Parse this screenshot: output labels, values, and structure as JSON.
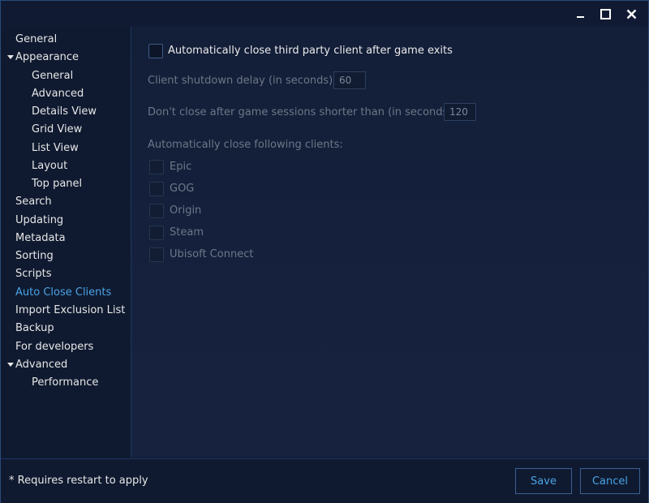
{
  "window": {
    "controls": {
      "minimize": "minimize-icon",
      "maximize": "maximize-icon",
      "close": "close-icon"
    }
  },
  "sidebar": {
    "items": [
      {
        "label": "General",
        "level": 0
      },
      {
        "label": "Appearance",
        "level": 0,
        "expanded": true
      },
      {
        "label": "General",
        "level": 1
      },
      {
        "label": "Advanced",
        "level": 1
      },
      {
        "label": "Details View",
        "level": 1
      },
      {
        "label": "Grid View",
        "level": 1
      },
      {
        "label": "List View",
        "level": 1
      },
      {
        "label": "Layout",
        "level": 1
      },
      {
        "label": "Top panel",
        "level": 1
      },
      {
        "label": "Search",
        "level": 0
      },
      {
        "label": "Updating",
        "level": 0
      },
      {
        "label": "Metadata",
        "level": 0
      },
      {
        "label": "Sorting",
        "level": 0
      },
      {
        "label": "Scripts",
        "level": 0
      },
      {
        "label": "Auto Close Clients",
        "level": 0,
        "selected": true
      },
      {
        "label": "Import Exclusion List",
        "level": 0
      },
      {
        "label": "Backup",
        "level": 0
      },
      {
        "label": "For developers",
        "level": 0
      },
      {
        "label": "Advanced",
        "level": 0,
        "expanded": true
      },
      {
        "label": "Performance",
        "level": 1
      }
    ]
  },
  "content": {
    "auto_close_label": "Automatically close third party client after game exits",
    "auto_close_checked": false,
    "shutdown_delay_label": "Client shutdown delay (in seconds)",
    "shutdown_delay_value": "60",
    "min_session_label": "Don't close after game sessions shorter than (in seconds)",
    "min_session_value": "120",
    "clients_heading": "Automatically close following clients:",
    "clients": [
      {
        "label": "Epic",
        "checked": false
      },
      {
        "label": "GOG",
        "checked": false
      },
      {
        "label": "Origin",
        "checked": false
      },
      {
        "label": "Steam",
        "checked": false
      },
      {
        "label": "Ubisoft Connect",
        "checked": false
      }
    ]
  },
  "footer": {
    "note": "* Requires restart to apply",
    "save_label": "Save",
    "cancel_label": "Cancel"
  },
  "colors": {
    "accent": "#4aa3e6",
    "background": "#0f1a30",
    "border": "#2a4a78",
    "text": "#e6e6e6",
    "disabled_text": "#6d7788"
  }
}
